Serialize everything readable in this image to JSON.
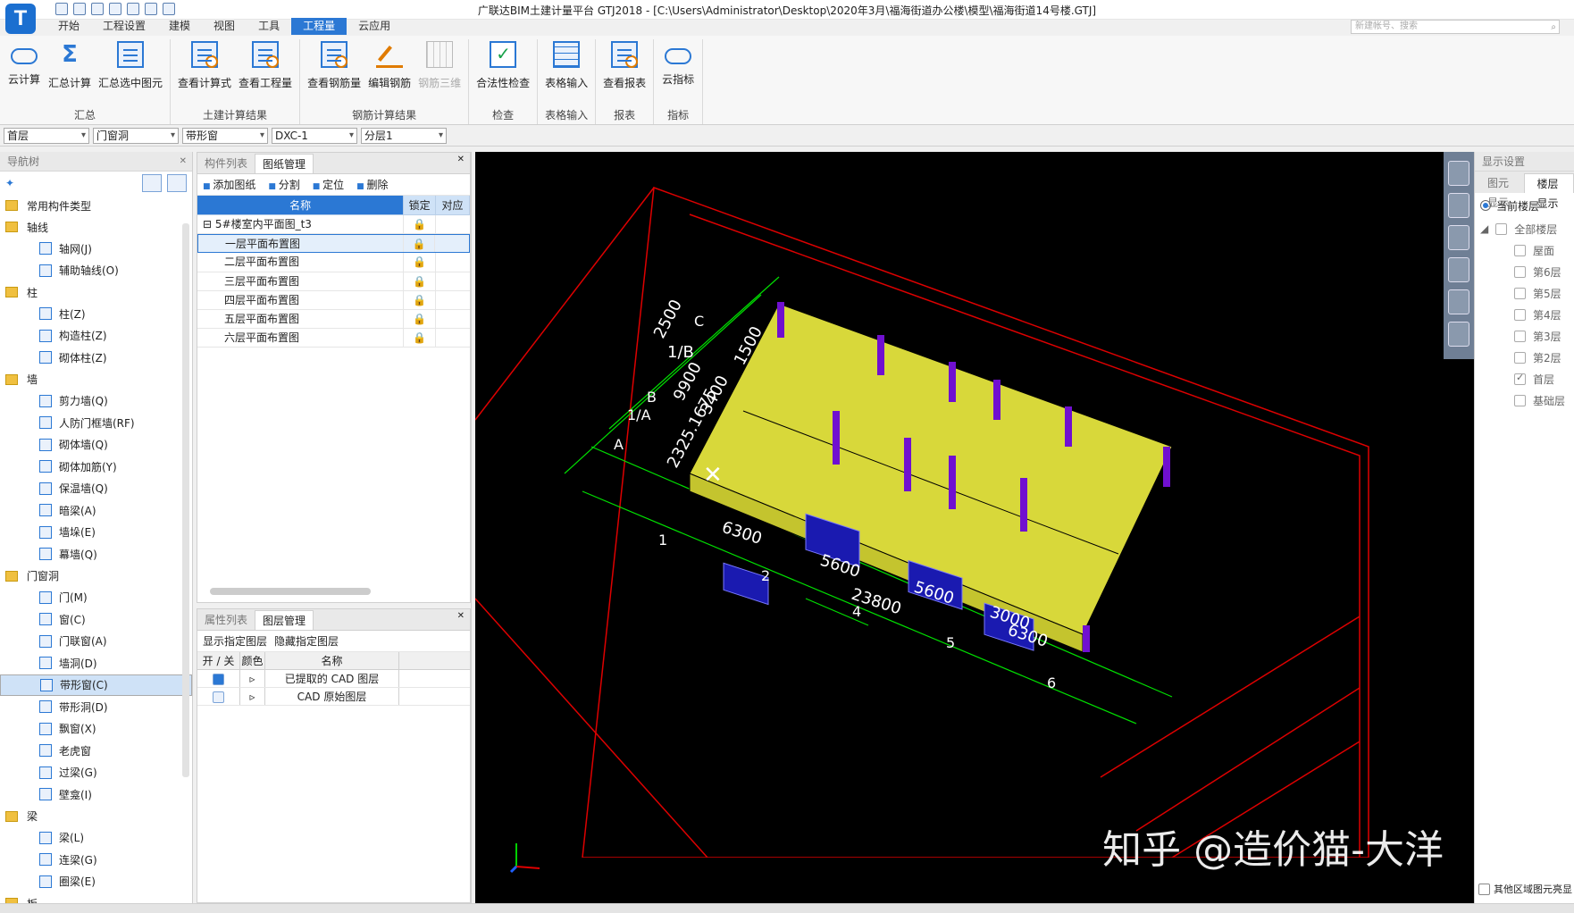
{
  "title": "广联达BIM土建计量平台 GTJ2018 - [C:\\Users\\Administrator\\Desktop\\2020年3月\\福海街道办公楼\\模型\\福海街道14号楼.GTJ]",
  "logo": "T",
  "search_placeholder": "新建帐号、搜索",
  "menu_tabs": [
    "开始",
    "工程设置",
    "建模",
    "视图",
    "工具",
    "工程量",
    "云应用"
  ],
  "ribbon": {
    "g1": {
      "label": "汇总",
      "b": [
        "云计算",
        "汇总计算",
        "汇总选中图元"
      ]
    },
    "g2": {
      "label": "土建计算结果",
      "b": [
        "查看计算式",
        "查看工程量"
      ]
    },
    "g3": {
      "label": "钢筋计算结果",
      "b": [
        "查看钢筋量",
        "编辑钢筋",
        "钢筋三维"
      ]
    },
    "g4": {
      "label": "检查",
      "b": [
        "合法性检查"
      ]
    },
    "g5": {
      "label": "表格输入",
      "b": [
        "表格输入"
      ]
    },
    "g6": {
      "label": "报表",
      "b": [
        "查看报表"
      ]
    },
    "g7": {
      "label": "指标",
      "b": [
        "云指标"
      ]
    }
  },
  "selectors": [
    "首层",
    "门窗洞",
    "带形窗",
    "DXC-1",
    "分层1"
  ],
  "nav": {
    "title": "导航树",
    "cats": [
      "常用构件类型",
      "轴线",
      "柱",
      "墙",
      "门窗洞",
      "梁",
      "板"
    ],
    "axis_items": [
      "轴网(J)",
      "辅助轴线(O)"
    ],
    "col_items": [
      "柱(Z)",
      "构造柱(Z)",
      "砌体柱(Z)"
    ],
    "wall_items": [
      "剪力墙(Q)",
      "人防门框墙(RF)",
      "砌体墙(Q)",
      "砌体加筋(Y)",
      "保温墙(Q)",
      "暗梁(A)",
      "墙垛(E)",
      "幕墙(Q)"
    ],
    "door_items": [
      "门(M)",
      "窗(C)",
      "门联窗(A)",
      "墙洞(D)",
      "带形窗(C)",
      "带形洞(D)",
      "飘窗(X)",
      "老虎窗",
      "过梁(G)",
      "壁龛(I)"
    ],
    "beam_items": [
      "梁(L)",
      "连梁(G)",
      "圈梁(E)"
    ]
  },
  "mid": {
    "tabs": [
      "构件列表",
      "图纸管理"
    ],
    "tools": [
      "添加图纸",
      "分割",
      "定位",
      "删除"
    ],
    "headers": [
      "名称",
      "锁定",
      "对应"
    ],
    "root": "5#楼室内平面图_t3",
    "rows": [
      "一层平面布置图",
      "二层平面布置图",
      "三层平面布置图",
      "四层平面布置图",
      "五层平面布置图",
      "六层平面布置图"
    ],
    "lower_tabs": [
      "属性列表",
      "图层管理"
    ],
    "layer_tools": [
      "显示指定图层",
      "隐藏指定图层"
    ],
    "layer_headers": [
      "开 / 关",
      "颜色",
      "名称"
    ],
    "layers": [
      "已提取的 CAD 图层",
      "CAD 原始图层"
    ]
  },
  "right": {
    "title": "显示设置",
    "tabs": [
      "图元显示",
      "楼层显示"
    ],
    "radio": "当前楼层",
    "all": "全部楼层",
    "floors": [
      "屋面",
      "第6层",
      "第5层",
      "第4层",
      "第3层",
      "第2层",
      "首层",
      "基础层"
    ],
    "bottom": "其他区域图元亮显"
  },
  "canvas": {
    "dims": [
      "6300",
      "5600",
      "23800",
      "5600",
      "3000",
      "6300",
      "2500",
      "1/B",
      "9900",
      "3400",
      "1500",
      "2325.1675"
    ],
    "axis_labels": [
      "C",
      "B",
      "1/A",
      "A",
      "1",
      "2",
      "4",
      "5",
      "6"
    ],
    "watermark": "知乎 @造价猫-大洋"
  }
}
